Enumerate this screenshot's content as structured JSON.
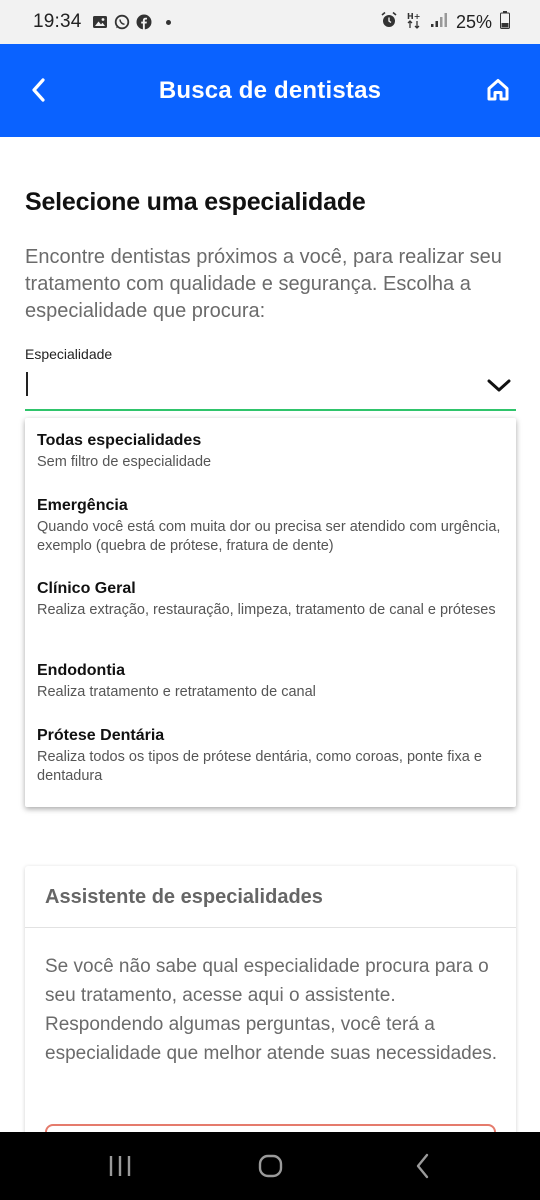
{
  "status_bar": {
    "time": "19:34",
    "battery": "25%",
    "left_icons": [
      "image-icon",
      "whatsapp-icon",
      "facebook-icon",
      "dot-icon"
    ],
    "right_icons": [
      "alarm-icon",
      "data-arrows-icon",
      "signal-icon",
      "battery-icon"
    ]
  },
  "app_bar": {
    "title": "Busca de dentistas",
    "color": "#0a62ff"
  },
  "main": {
    "heading": "Selecione uma especialidade",
    "intro": "Encontre dentistas próximos a você, para realizar seu tratamento com qualidade e segurança. Escolha a especialidade que procura:",
    "field_label": "Especialidade",
    "field_value": ""
  },
  "dropdown": {
    "options": [
      {
        "title": "Todas especialidades",
        "description": "Sem filtro de especialidade"
      },
      {
        "title": "Emergência",
        "description": "Quando você está com muita dor ou precisa ser atendido com urgência, exemplo (quebra de prótese, fratura de dente)"
      },
      {
        "title": "Clínico Geral",
        "description": "Realiza extração, restauração, limpeza, tratamento de canal e próteses"
      },
      {
        "title": "Endodontia",
        "description": "Realiza tratamento e retratamento de canal"
      },
      {
        "title": "Prótese Dentária",
        "description": "Realiza todos os tipos de prótese dentária, como coroas, ponte fixa e dentadura"
      }
    ]
  },
  "assistant_card": {
    "title": "Assistente de especialidades",
    "body": "Se você não sabe qual especialidade procura para o seu tratamento, acesse aqui o assistente. Respondendo algumas perguntas, você terá a especialidade que melhor atende suas necessidades."
  },
  "colors": {
    "accent_green": "#2fc46b",
    "button_border": "#e57b6c"
  }
}
